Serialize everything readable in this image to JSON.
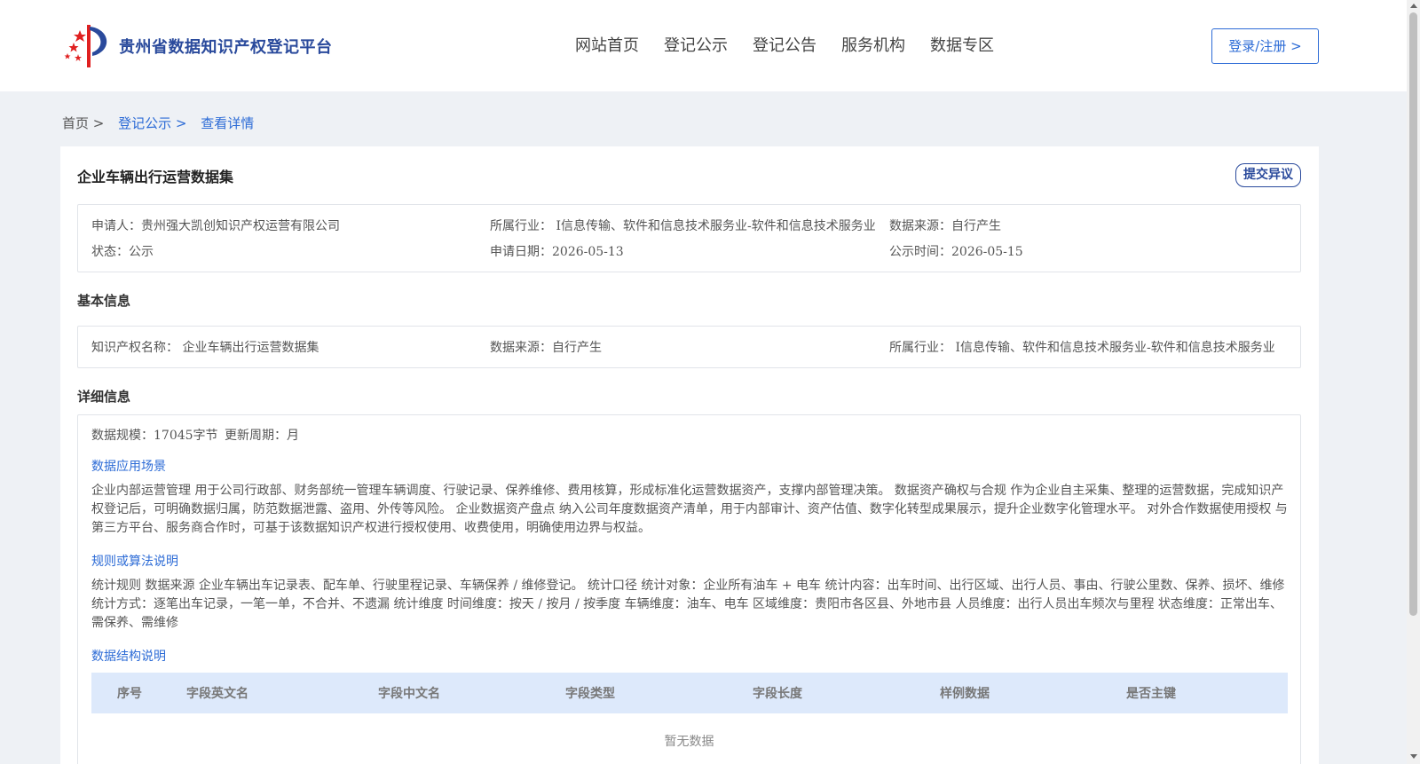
{
  "header": {
    "site_title": "贵州省数据知识产权登记平台",
    "nav": [
      "网站首页",
      "登记公示",
      "登记公告",
      "服务机构",
      "数据专区"
    ],
    "login_label": "登录/注册 >"
  },
  "breadcrumb": {
    "home": "首页 >",
    "level1": "登记公示 >",
    "current": "查看详情"
  },
  "detail": {
    "title": "企业车辆出行运营数据集",
    "objection_label": "提交异议",
    "summary": {
      "applicant": "申请人：贵州强大凯创知识产权运营有限公司",
      "industry": "所属行业： I信息传输、软件和信息技术服务业-软件和信息技术服务业",
      "source": "数据来源：自行产生",
      "status": "状态：公示",
      "apply_date": "申请日期：2026-05-13",
      "publish_date": "公示时间：2026-05-15"
    },
    "basic_title": "基本信息",
    "basic": {
      "ip_name": "知识产权名称： 企业车辆出行运营数据集",
      "source": "数据来源：自行产生",
      "industry": "所属行业： I信息传输、软件和信息技术服务业-软件和信息技术服务业"
    },
    "detail_title": "详细信息",
    "scale": "数据规模：17045字节",
    "cycle": "更新周期：月",
    "scenario_title": "数据应用场景",
    "scenario_text": "企业内部运营管理 用于公司行政部、财务部统一管理车辆调度、行驶记录、保养维修、费用核算，形成标准化运营数据资产，支撑内部管理决策。 数据资产确权与合规 作为企业自主采集、整理的运营数据，完成知识产权登记后，可明确数据归属，防范数据泄露、盗用、外传等风险。 企业数据资产盘点 纳入公司年度数据资产清单，用于内部审计、资产估值、数字化转型成果展示，提升企业数字化管理水平。 对外合作数据使用授权 与第三方平台、服务商合作时，可基于该数据知识产权进行授权使用、收费使用，明确使用边界与权益。",
    "rules_title": "规则或算法说明",
    "rules_text": "统计规则 数据来源 企业车辆出车记录表、配车单、行驶里程记录、车辆保养 / 维修登记。 统计口径 统计对象：企业所有油车 + 电车 统计内容：出车时间、出行区域、出行人员、事由、行驶公里数、保养、损坏、维修 统计方式：逐笔出车记录，一笔一单，不合并、不遗漏 统计维度 时间维度：按天 / 按月 / 按季度 车辆维度：油车、电车 区域维度：贵阳市各区县、外地市县 人员维度：出行人员出车频次与里程 状态维度：正常出车、需保养、需维修",
    "structure_title": "数据结构说明",
    "table_headers": [
      "序号",
      "字段英文名",
      "字段中文名",
      "字段类型",
      "字段长度",
      "样例数据",
      "是否主键"
    ],
    "empty_text": "暂无数据"
  },
  "colors": {
    "accent": "#2c6bd6",
    "brand": "#2a4a9c",
    "table_header_bg": "#dde9fb",
    "page_bg": "#eef1f5"
  }
}
